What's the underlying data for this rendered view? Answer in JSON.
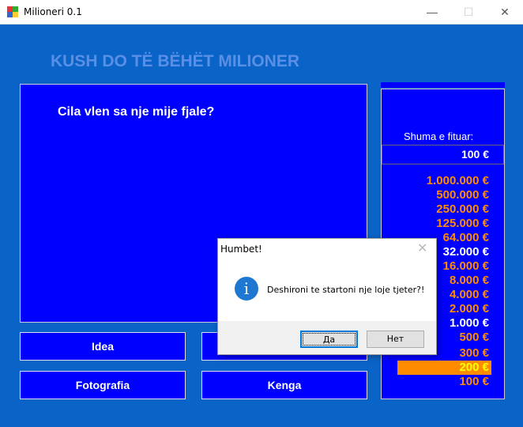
{
  "window": {
    "title": "Milioneri 0.1",
    "minimize": "—",
    "maximize": "☐",
    "close": "✕"
  },
  "heading": "KUSH DO TË BËHËT MILIONER",
  "question": "Cila vlen sa nje mije fjale?",
  "lifelines": [
    {
      "label": "Idea"
    },
    {
      "label": ""
    },
    {
      "label": "Fotografia"
    },
    {
      "label": "Kenga"
    }
  ],
  "prize": {
    "won_label": "Shuma e fituar:",
    "won_value": "100 €",
    "ladder": [
      {
        "label": "1.000.000 €",
        "color": "#ff8c00"
      },
      {
        "label": "500.000 €",
        "color": "#ff8c00"
      },
      {
        "label": "250.000 €",
        "color": "#ff8c00"
      },
      {
        "label": "125.000 €",
        "color": "#ff8c00"
      },
      {
        "label": "64.000 €",
        "color": "#ff8c00"
      },
      {
        "label": "32.000 €",
        "color": "#ffffff"
      },
      {
        "label": "16.000 €",
        "color": "#ff8c00"
      },
      {
        "label": "8.000 €",
        "color": "#ff8c00"
      },
      {
        "label": "4.000 €",
        "color": "#ff8c00"
      },
      {
        "label": "2.000 €",
        "color": "#ff8c00"
      },
      {
        "label": "1.000 €",
        "color": "#ffffff"
      },
      {
        "label": "500 €",
        "color": "#ff8c00"
      },
      {
        "label": "300 €",
        "color": "#ff8c00"
      },
      {
        "label": "200 €",
        "color": "#ffff00",
        "current": true
      },
      {
        "label": "100 €",
        "color": "#ff8c00"
      }
    ],
    "highlight_color": "#ff8c00"
  },
  "dialog": {
    "title": "Humbet!",
    "close": "✕",
    "icon": "info-icon",
    "icon_glyph": "i",
    "message": "Deshironi te startoni nje loje tjeter?!",
    "yes": "Да",
    "no": "Нет"
  }
}
